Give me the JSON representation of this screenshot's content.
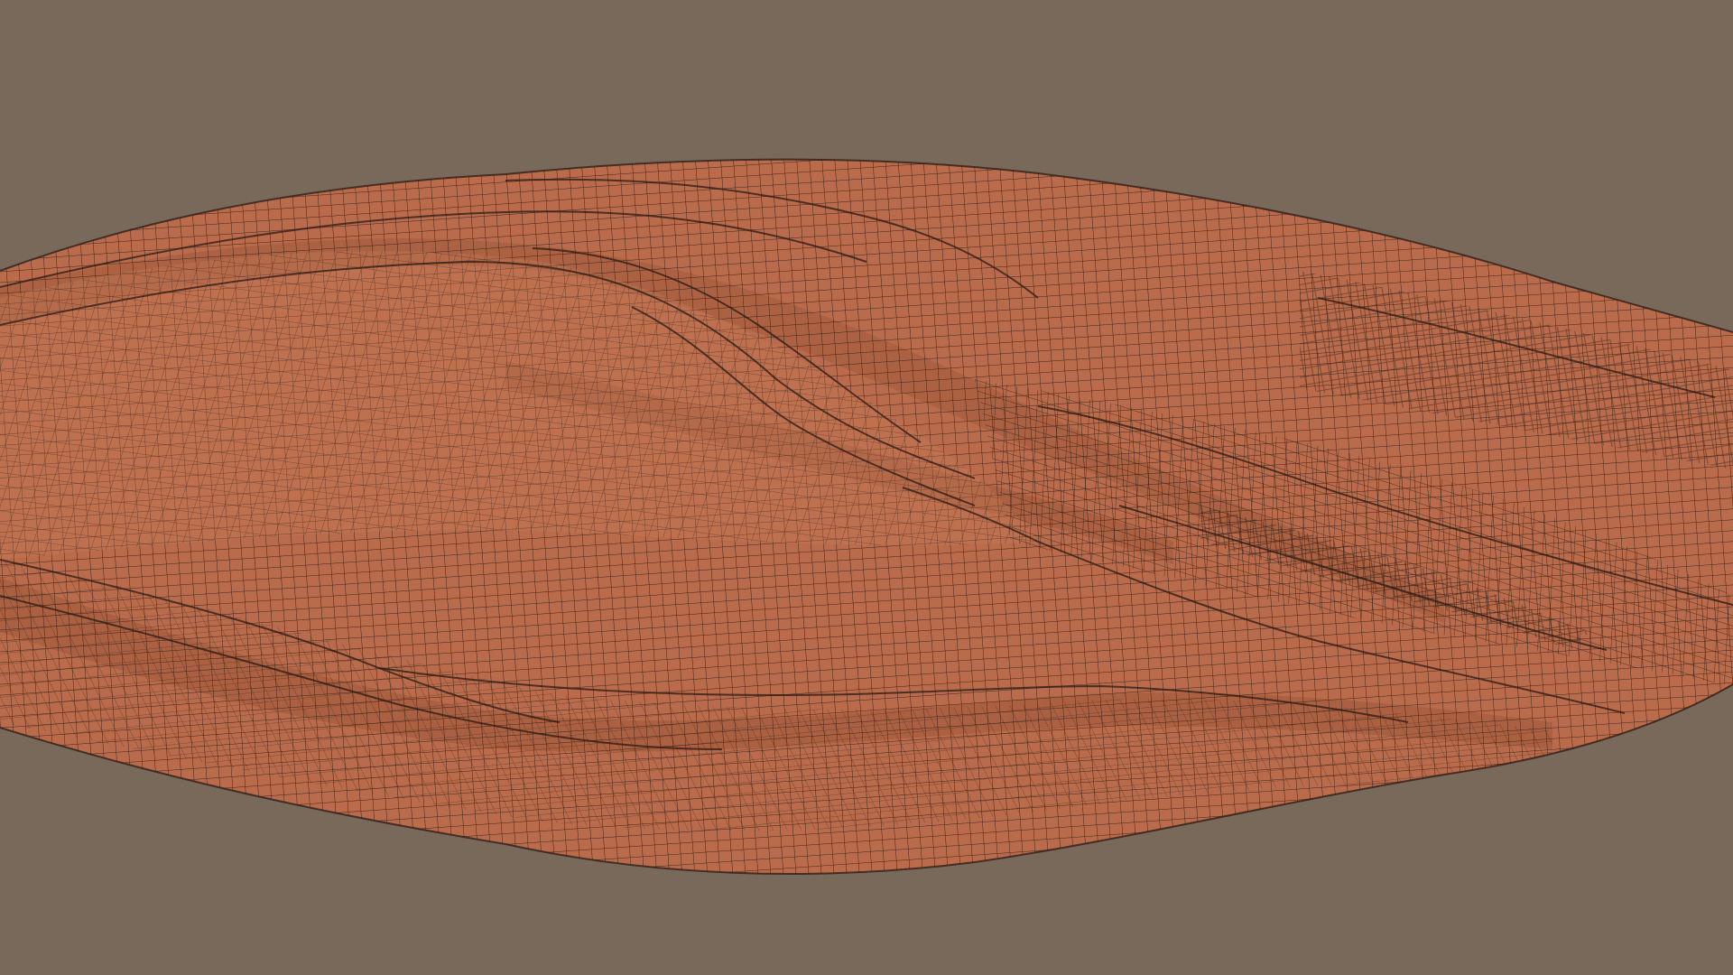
{
  "viewport": {
    "background_color": "#78695a",
    "mesh_fill_color": "#b96b4b",
    "mesh_shadow_color": "#9c5638",
    "mesh_highlight_color": "#c97c59",
    "wire_color": "#2a1a14",
    "render_mode": "wireframe-on-shaded",
    "object": "muscle-mesh"
  }
}
